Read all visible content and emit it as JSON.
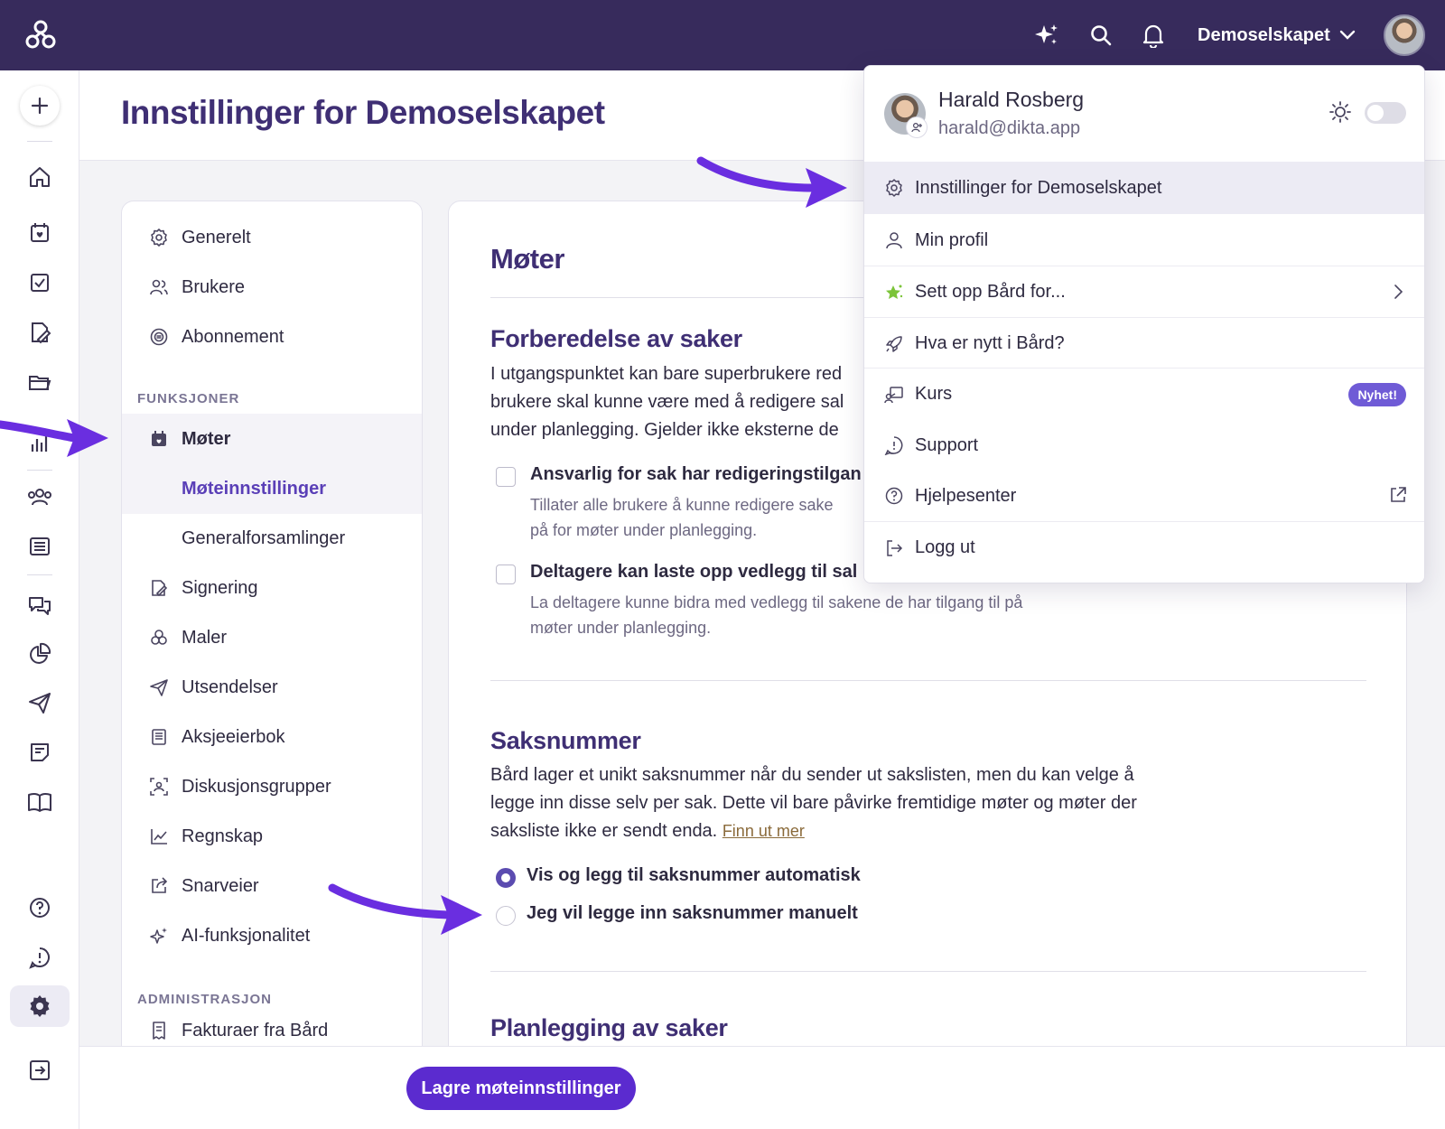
{
  "topbar": {
    "org_name": "Demoselskapet",
    "icons": [
      "logo-icon",
      "sparkle-icon",
      "search-icon",
      "bell-icon",
      "chevron-down-icon"
    ]
  },
  "header": {
    "title": "Innstillinger for Demoselskapet"
  },
  "settings_nav": {
    "items_top": [
      {
        "label": "Generelt",
        "icon": "gear-icon"
      },
      {
        "label": "Brukere",
        "icon": "users-icon"
      },
      {
        "label": "Abonnement",
        "icon": "subscription-icon"
      }
    ],
    "section_functions": "FUNKSJONER",
    "items_functions": [
      {
        "label": "Møter",
        "icon": "calendar-icon"
      },
      {
        "label": "Møteinnstillinger"
      },
      {
        "label": "Generalforsamlinger"
      },
      {
        "label": "Signering",
        "icon": "sign-icon"
      },
      {
        "label": "Maler",
        "icon": "templates-icon"
      },
      {
        "label": "Utsendelser",
        "icon": "send-icon"
      },
      {
        "label": "Aksjeeierbok",
        "icon": "book-icon"
      },
      {
        "label": "Diskusjonsgrupper",
        "icon": "group-icon"
      },
      {
        "label": "Regnskap",
        "icon": "chart-line-icon"
      },
      {
        "label": "Snarveier",
        "icon": "shortcut-icon"
      },
      {
        "label": "AI-funksjonalitet",
        "icon": "sparkle-icon"
      }
    ],
    "section_admin": "ADMINISTRASJON",
    "items_admin": [
      {
        "label": "Fakturaer fra Bård",
        "icon": "invoice-icon"
      }
    ]
  },
  "content": {
    "title": "Møter",
    "prep": {
      "heading": "Forberedelse av saker",
      "text_lines": [
        "I utgangspunktet kan bare superbrukere red",
        "brukere skal kunne være med å redigere sal",
        "under planlegging. Gjelder ikke eksterne de"
      ],
      "option1_title": "Ansvarlig for sak har redigeringstilgan",
      "option1_desc": [
        "Tillater alle brukere å kunne redigere sake",
        "på for møter under planlegging."
      ],
      "option2_title": "Deltagere kan laste opp vedlegg til sal",
      "option2_desc": [
        "La deltagere kunne bidra med vedlegg til sakene de har tilgang til på",
        "møter under planlegging."
      ]
    },
    "case_number": {
      "heading": "Saksnummer",
      "text_lines": [
        "Bård lager et unikt saksnummer når du sender ut sakslisten, men du kan velge å",
        "legge inn disse selv per sak. Dette vil bare påvirke fremtidige møter og møter der",
        "saksliste ikke er sendt enda."
      ],
      "link": "Finn ut mer",
      "radio_auto": "Vis og legg til saksnummer automatisk",
      "radio_manual": "Jeg vil legge inn saksnummer manuelt",
      "selected": "auto"
    },
    "planning": {
      "heading": "Planlegging av saker"
    }
  },
  "footer": {
    "save_label": "Lagre møteinnstillinger"
  },
  "user_menu": {
    "name": "Harald Rosberg",
    "email": "harald@dikta.app",
    "dark_mode": false,
    "items": [
      {
        "label": "Innstillinger for Demoselskapet",
        "icon": "gear-icon"
      },
      {
        "label": "Min profil",
        "icon": "user-icon"
      },
      {
        "label": "Sett opp Bård for...",
        "icon": "star-icon"
      },
      {
        "label": "Hva er nytt i Bård?",
        "icon": "rocket-icon"
      },
      {
        "label": "Kurs",
        "icon": "course-icon",
        "badge": "Nyhet!"
      },
      {
        "label": "Support",
        "icon": "support-icon"
      },
      {
        "label": "Hjelpesenter",
        "icon": "help-icon"
      },
      {
        "label": "Logg ut",
        "icon": "logout-icon"
      }
    ]
  },
  "colors": {
    "topbar": "#372b5c",
    "accent": "#5b2bcf",
    "heading": "#3f2f74",
    "arrow": "#6a2ee0",
    "badge": "#6f5bd6"
  }
}
